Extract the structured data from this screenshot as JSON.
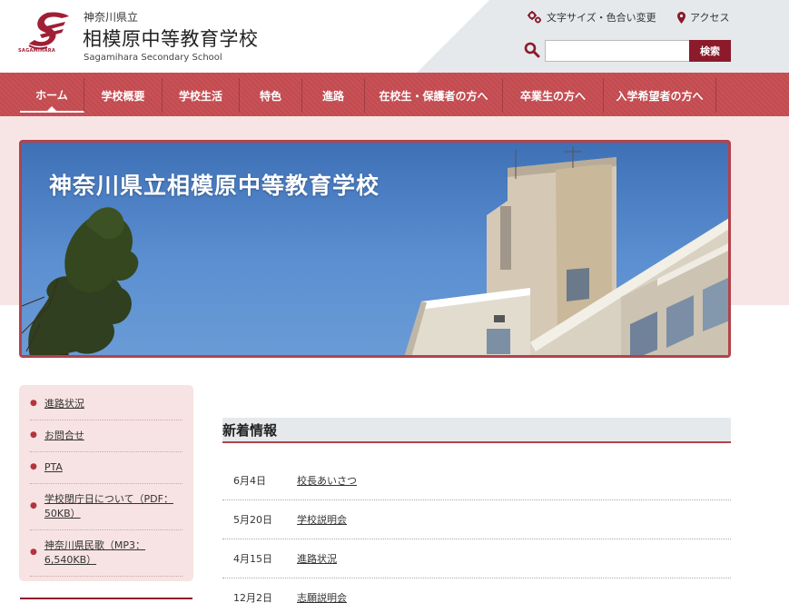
{
  "header": {
    "prefecture": "神奈川県立",
    "school_name": "相模原中等教育学校",
    "school_name_en": "Sagamihara Secondary School",
    "logo_text": "SAGAMIHARA",
    "text_size_label": "文字サイズ・色合い変更",
    "access_label": "アクセス",
    "search_placeholder": "",
    "search_button": "検索"
  },
  "nav": {
    "items": [
      {
        "label": "ホーム",
        "active": true
      },
      {
        "label": "学校概要"
      },
      {
        "label": "学校生活"
      },
      {
        "label": "特色"
      },
      {
        "label": "進路"
      },
      {
        "label": "在校生・保護者の方へ"
      },
      {
        "label": "卒業生の方へ"
      },
      {
        "label": "入学希望者の方へ"
      }
    ]
  },
  "hero": {
    "title": "神奈川県立相模原中等教育学校"
  },
  "sidebar": {
    "items": [
      {
        "label": "進路状況"
      },
      {
        "label": "お問合せ"
      },
      {
        "label": "PTA"
      },
      {
        "label": "学校閉庁日について（PDF：50KB）"
      },
      {
        "label": "神奈川県民歌（MP3：6,540KB）"
      }
    ]
  },
  "news": {
    "heading": "新着情報",
    "items": [
      {
        "date": "6月4日",
        "title": "校長あいさつ"
      },
      {
        "date": "5月20日",
        "title": "学校説明会"
      },
      {
        "date": "4月15日",
        "title": "進路状況"
      },
      {
        "date": "12月2日",
        "title": "志願説明会"
      }
    ]
  },
  "colors": {
    "brand": "#8b1a2b",
    "nav": "#c34a4f",
    "band": "#f7e5e5"
  }
}
